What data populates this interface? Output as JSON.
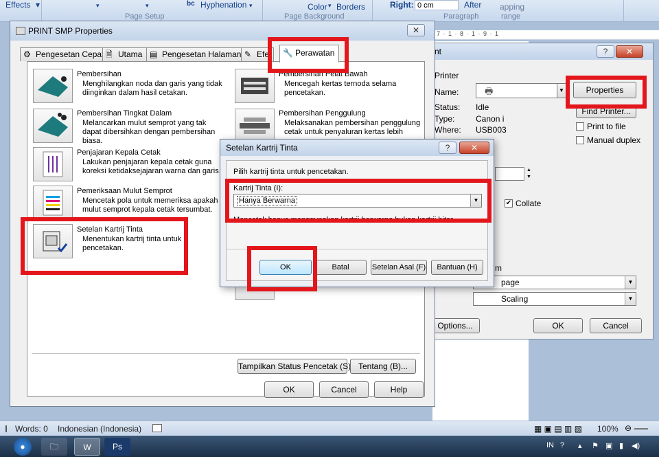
{
  "ribbon": {
    "effects": "Effects",
    "hyphenation": "Hyphenation",
    "page_setup": "Page Setup",
    "color": "Color",
    "borders": "Borders",
    "page_background": "Page Background",
    "right_label": "Right:",
    "right_value": "0 cm",
    "paragraph": "Paragraph",
    "after": "After",
    "wrapping": "apping",
    "arrange": "range"
  },
  "ruler": "7 · 1 · 8 · 1 · 9 · 1",
  "print_dialog": {
    "title": "nt",
    "printer_group": "Printer",
    "name_label": "Name:",
    "properties_button": "Properties",
    "find_printer_button": "Find Printer...",
    "status_label": "Status:",
    "status_value": "Idle",
    "type_label": "Type:",
    "type_value": "Canon i",
    "where_label": "Where:",
    "where_value": "USB003",
    "print_to_file": "Print to file",
    "manual_duplex": "Manual duplex",
    "collate": "Collate",
    "zoom_group": "m",
    "pages_per_sheet_value": "page",
    "scaling_value": "Scaling",
    "options_button": "Options...",
    "ok_button": "OK",
    "cancel_button": "Cancel"
  },
  "props_dialog": {
    "title": "PRINT SMP Properties",
    "tabs": [
      "Pengesetan Cepat",
      "Utama",
      "Pengesetan Halaman",
      "Efe",
      "Perawatan"
    ],
    "items_left": [
      {
        "title": "Pembersihan",
        "desc": "Menghilangkan noda dan garis yang tidak diinginkan dalam hasil cetakan."
      },
      {
        "title": "Pembersihan Tingkat Dalam",
        "desc": "Melancarkan mulut semprot yang tak dapat dibersihkan dengan pembersihan biasa."
      },
      {
        "title": "Penjajaran Kepala Cetak",
        "desc": "Lakukan penjajaran kepala cetak guna koreksi ketidaksejajaran warna dan garis."
      },
      {
        "title": "Pemeriksaan Mulut Semprot",
        "desc": "Mencetak pola untuk memeriksa apakah mulut semprot kepala cetak tersumbat."
      },
      {
        "title": "Setelan Kartrij Tinta",
        "desc": "Menentukan kartrij tinta untuk pencetakan."
      }
    ],
    "items_right": [
      {
        "title": "Pembersihan Pelat Bawah",
        "desc": "Mencegah kertas ternoda selama pencetakan."
      },
      {
        "title": "Pembersihan Penggulung",
        "desc": "Melaksanakan pembersihan penggulung cetak untuk penyaluran kertas lebih"
      }
    ],
    "show_status_button": "Tampilkan Status Pencetak (S)...",
    "about_button": "Tentang (B)...",
    "ok_button": "OK",
    "cancel_button": "Cancel",
    "help_button": "Help"
  },
  "cartridge_dialog": {
    "title": "Setelan Kartrij Tinta",
    "instruction": "Pilih kartrij tinta untuk pencetakan.",
    "combo_label": "Kartrij Tinta (I):",
    "combo_value": "Hanya Berwarna",
    "hint": "Mencetak hanya menggunakan kartrij berwarna bukan kartrij hitam.",
    "ok_button": "OK",
    "cancel_button": "Batal",
    "defaults_button": "Setelan Asal (F)",
    "help_button": "Bantuan (H)"
  },
  "statusbar": {
    "words": "Words: 0",
    "language": "Indonesian (Indonesia)",
    "zoom": "100%"
  },
  "taskbar": {
    "language": "IN"
  },
  "colors": {
    "highlight": "#e3161b",
    "dialog_bg": "#f0f0f0",
    "ribbon_text": "#15428b"
  }
}
